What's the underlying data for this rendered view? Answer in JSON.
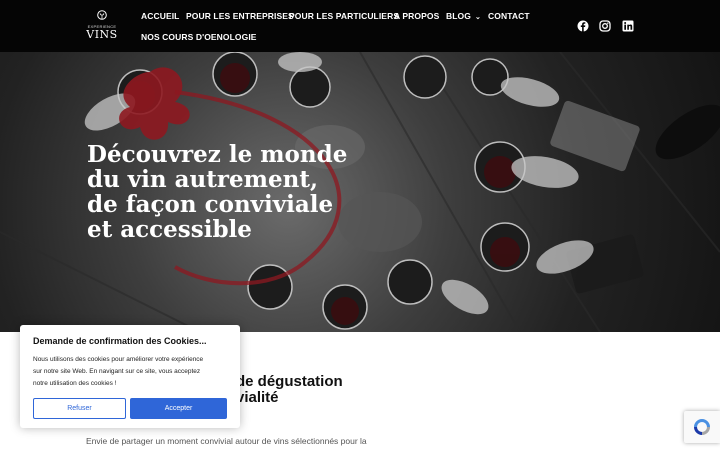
{
  "header": {
    "logo": {
      "small_text": "EXPERIENCE",
      "big_text": "VINS"
    },
    "nav": [
      {
        "label": "ACCUEIL"
      },
      {
        "label": "POUR LES ENTREPRISES"
      },
      {
        "label": "POUR LES PARTICULIERS"
      },
      {
        "label": "A PROPOS"
      },
      {
        "label": "BLOG",
        "dropdown": true
      },
      {
        "label": "CONTACT"
      },
      {
        "label": "NOS COURS D'OENOLOGIE"
      }
    ],
    "social": [
      {
        "icon": "facebook-icon"
      },
      {
        "icon": "instagram-icon"
      },
      {
        "icon": "linkedin-icon"
      }
    ]
  },
  "hero": {
    "title_lines": [
      "Découvrez le monde",
      "du vin autrement,",
      "de façon conviviale",
      "et accessible"
    ],
    "colors": {
      "wine_splash": "#8e1820"
    }
  },
  "section": {
    "title_lines": [
      "de dégustation",
      "vialité"
    ],
    "text": "Envie de partager un moment convivial autour de vins sélectionnés pour la"
  },
  "cookie_banner": {
    "title": "Demande de confirmation des Cookies...",
    "body_lines": [
      "Nous utilisons des cookies pour améliorer votre expérience",
      "sur notre site Web. En navigant sur ce site, vous acceptez",
      "notre utilisation des cookies !"
    ],
    "refuse_label": "Refuser",
    "accept_label": "Accepter",
    "colors": {
      "accent": "#2f66d8"
    }
  }
}
